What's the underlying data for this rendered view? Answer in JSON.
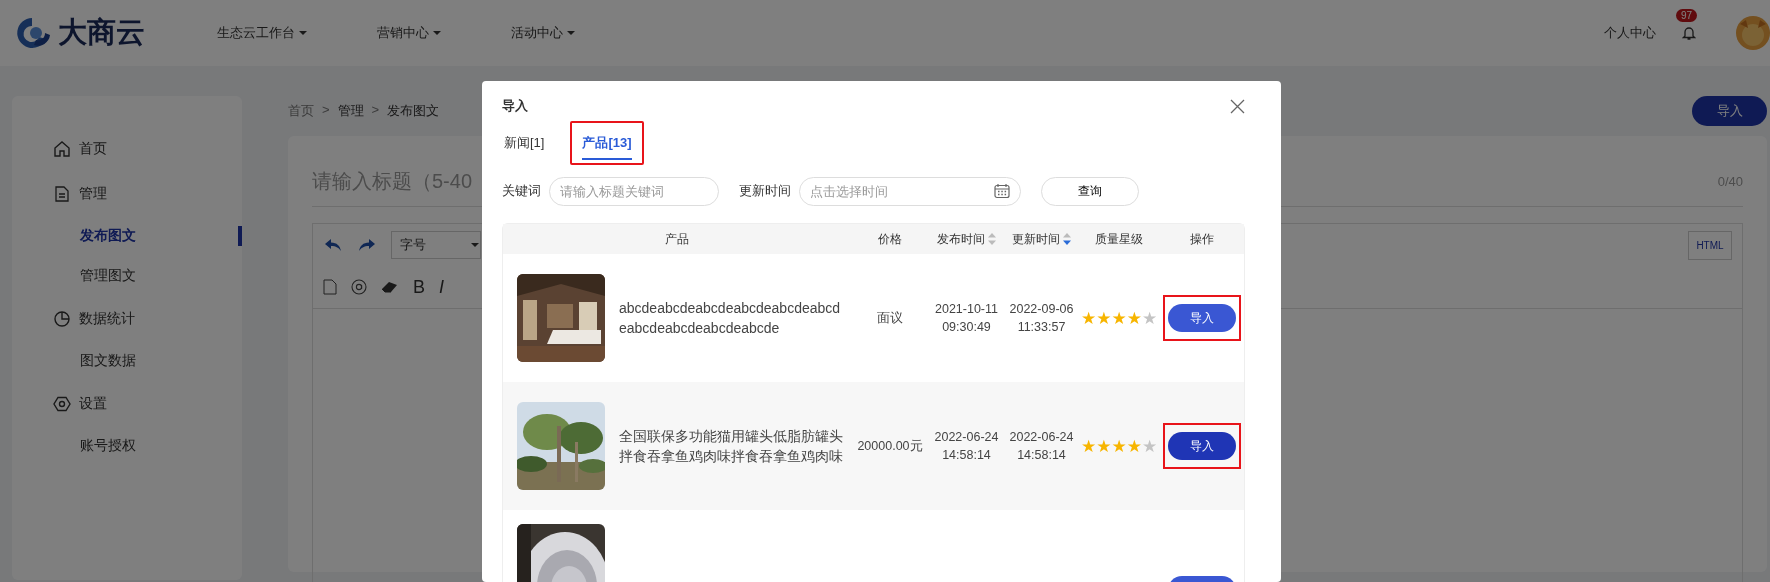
{
  "top_bar": {
    "logo": "大商云",
    "nav": [
      {
        "label": "生态云工作台"
      },
      {
        "label": "营销中心"
      },
      {
        "label": "活动中心"
      }
    ],
    "user_center": "个人中心",
    "notifications": "97"
  },
  "sidebar": {
    "items": [
      {
        "label": "首页"
      },
      {
        "label": "管理",
        "children": [
          {
            "label": "发布图文",
            "selected": true
          },
          {
            "label": "管理图文",
            "selected": false
          }
        ]
      },
      {
        "label": "数据统计",
        "children": [
          {
            "label": "图文数据",
            "selected": false
          }
        ]
      },
      {
        "label": "设置",
        "children": [
          {
            "label": "账号授权",
            "selected": false
          }
        ]
      }
    ]
  },
  "breadcrumb": {
    "items": [
      "首页",
      "管理",
      "发布图文"
    ],
    "separator": ">"
  },
  "import_button": "导入",
  "editor": {
    "title_placeholder": "请输入标题（5-40",
    "counter": "0/40",
    "font_size_select": "字号",
    "format_buttons": [
      "B",
      "I"
    ],
    "html_button": "HTML"
  },
  "dialog": {
    "title": "导入",
    "tabs": [
      {
        "label": "新闻[1]",
        "selected": false,
        "highlighted": false
      },
      {
        "label": "产品[13]",
        "selected": true,
        "highlighted": true
      }
    ],
    "filters": {
      "keyword_label": "关键词",
      "keyword_placeholder": "请输入标题关键词",
      "time_label": "更新时间",
      "time_placeholder": "点击选择时间",
      "query_button": "查询"
    },
    "table": {
      "columns": [
        {
          "label": "产品",
          "sortable": false,
          "sorted_desc": false
        },
        {
          "label": "价格",
          "sortable": false,
          "sorted_desc": false
        },
        {
          "label": "发布时间",
          "sortable": true,
          "sorted_desc": false
        },
        {
          "label": "更新时间",
          "sortable": true,
          "sorted_desc": true
        },
        {
          "label": "质量星级",
          "sortable": false,
          "sorted_desc": false
        },
        {
          "label": "操作",
          "sortable": false,
          "sorted_desc": false
        }
      ],
      "rows": [
        {
          "kind": "full",
          "name": "abcdeabcdeabcdeabcdeabcdeabcdeabcdeabcdeabcdeabcde",
          "price": "面议",
          "published": "2021-10-11 09:30:49",
          "updated": "2022-09-06 11:33:57",
          "stars": 4,
          "action": "导入",
          "hovered": true,
          "highlighted": true
        },
        {
          "kind": "full",
          "name": "全国联保多功能猫用罐头低脂肪罐头拌食吞拿鱼鸡肉味拌食吞拿鱼鸡肉味",
          "price": "20000.00元",
          "published": "2022-06-24 14:58:14",
          "updated": "2022-06-24 14:58:14",
          "stars": 4,
          "action": "导入",
          "hovered": false,
          "highlighted": true
        },
        {
          "kind": "partial"
        }
      ]
    }
  }
}
